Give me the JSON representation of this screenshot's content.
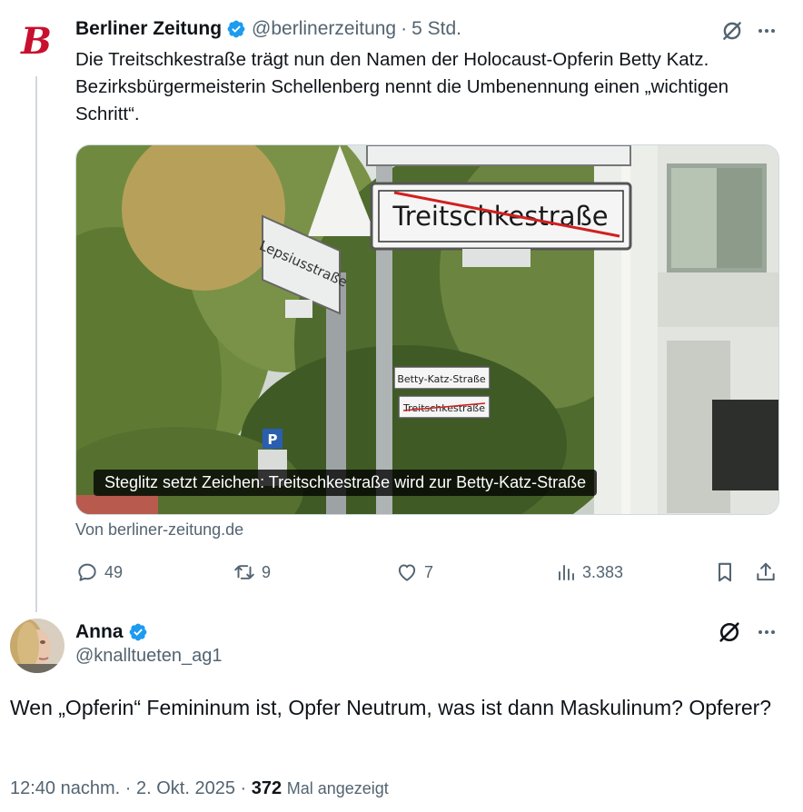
{
  "parent_tweet": {
    "avatar_letter": "B",
    "author_name": "Berliner Zeitung",
    "handle": "@berlinerzeitung",
    "separator": "·",
    "time": "5 Std.",
    "text": "Die Treitschkestraße trägt nun den Namen der Holocaust-Opferin Betty Katz. Bezirksbürgermeisterin Schellenberg nennt die Umbenennung einen „wichtigen Schritt“.",
    "media": {
      "caption": "Steglitz setzt Zeichen: Treitschkestraße wird zur Betty-Katz-Straße",
      "sign_main": "Treitschkestraße",
      "sign_left": "Lepsiusstraße",
      "sign_small_1": "Betty-Katz-Straße",
      "sign_small_2": "Treitschkestraße"
    },
    "source_label": "Von berliner-zeitung.de",
    "stats": {
      "replies": "49",
      "reposts": "9",
      "likes": "7",
      "views": "3.383"
    }
  },
  "reply_tweet": {
    "author_name": "Anna",
    "handle": "@knalltueten_ag1",
    "text": "Wen „Opferin“ Femininum ist, Opfer Neutrum, was ist dann Maskulinum? Opferer?",
    "time": "12:40 nachm.",
    "separator": "·",
    "date": "2. Okt. 2025",
    "views_count": "372",
    "views_label": "Mal angezeigt"
  },
  "colors": {
    "verified_blue": "#1d9bf0",
    "text_primary": "#0f1419",
    "text_secondary": "#536471",
    "brand_red": "#c8102e"
  },
  "icons": [
    "verified-badge-icon",
    "grok-icon",
    "more-icon",
    "reply-icon",
    "repost-icon",
    "like-icon",
    "views-icon",
    "bookmark-icon",
    "share-icon"
  ]
}
